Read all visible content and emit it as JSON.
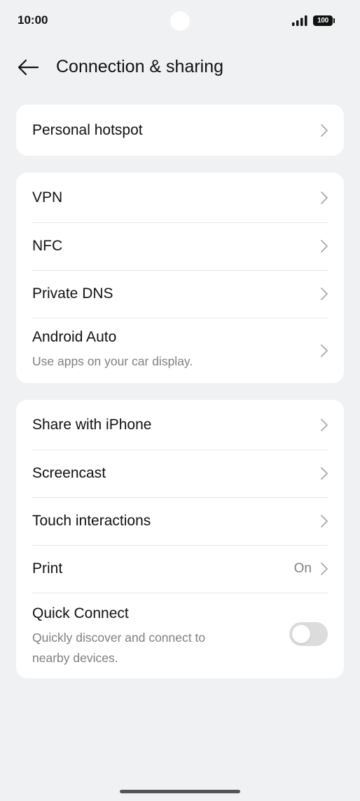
{
  "status_bar": {
    "time": "10:00",
    "battery": "100"
  },
  "header": {
    "title": "Connection & sharing"
  },
  "groups": [
    {
      "items": [
        {
          "title": "Personal hotspot"
        }
      ]
    },
    {
      "items": [
        {
          "title": "VPN"
        },
        {
          "title": "NFC"
        },
        {
          "title": "Private DNS"
        },
        {
          "title": "Android Auto",
          "subtitle": "Use apps on your car display."
        }
      ]
    },
    {
      "items": [
        {
          "title": "Share with iPhone"
        },
        {
          "title": "Screencast"
        },
        {
          "title": "Touch interactions"
        },
        {
          "title": "Print",
          "value": "On"
        },
        {
          "title": "Quick Connect",
          "subtitle_line1": "Quickly discover and connect to",
          "subtitle_line2": "nearby devices.",
          "toggle_on": false
        }
      ]
    }
  ],
  "colors": {
    "background": "#f0f1f3",
    "card": "#ffffff",
    "secondary_text": "#808080",
    "toggle_off": "#dcdcdc"
  }
}
